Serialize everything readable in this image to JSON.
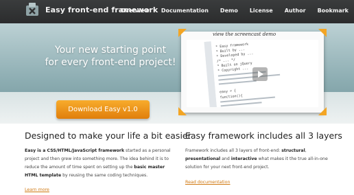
{
  "header": {
    "brand": "Easy front-end framework",
    "logo_icon": "x-box-logo-icon",
    "nav": [
      "Overview",
      "Documentation",
      "Demo",
      "License",
      "Author",
      "Bookmark"
    ]
  },
  "hero": {
    "tagline_line1": "Your new starting point",
    "tagline_line2": "for every front-end project!",
    "download_label": "Download Easy v1.0",
    "screencast_label": "view the screencast demo",
    "code_lines": [
      "* Easy framework",
      "* Built by ...",
      "* Developed by ...",
      "/* ... */",
      "* Built on jQuery",
      "* Copyright ...",
      "easy = {",
      "function(){"
    ]
  },
  "left": {
    "title": "Designed to make your life a bit easier",
    "p_bold1": "Easy is a CSS/HTML/JavaScript framework",
    "p_text1": " started as a personal project and then grew into something more. The idea behind it is to reduce the amount of time spent on setting up the ",
    "p_bold2": "basic master HTML template",
    "p_text2": " by reusing the same coding techniques.",
    "link": "Learn more"
  },
  "right": {
    "title": "Easy framework includes all 3 layers",
    "p_text1": "Framework includes all 3 layers of front-end: ",
    "p_bold1": "structural",
    "p_text2": ", ",
    "p_bold2": "presentational",
    "p_text3": " and ",
    "p_bold3": "interactive",
    "p_text4": " what makes it the true all-in-one solution for your next front-end project.",
    "link": "Read documentation"
  },
  "colors": {
    "topbar": "#2f3031",
    "accent_orange": "#e9890f",
    "hero_teal": "#8eaeb3"
  }
}
